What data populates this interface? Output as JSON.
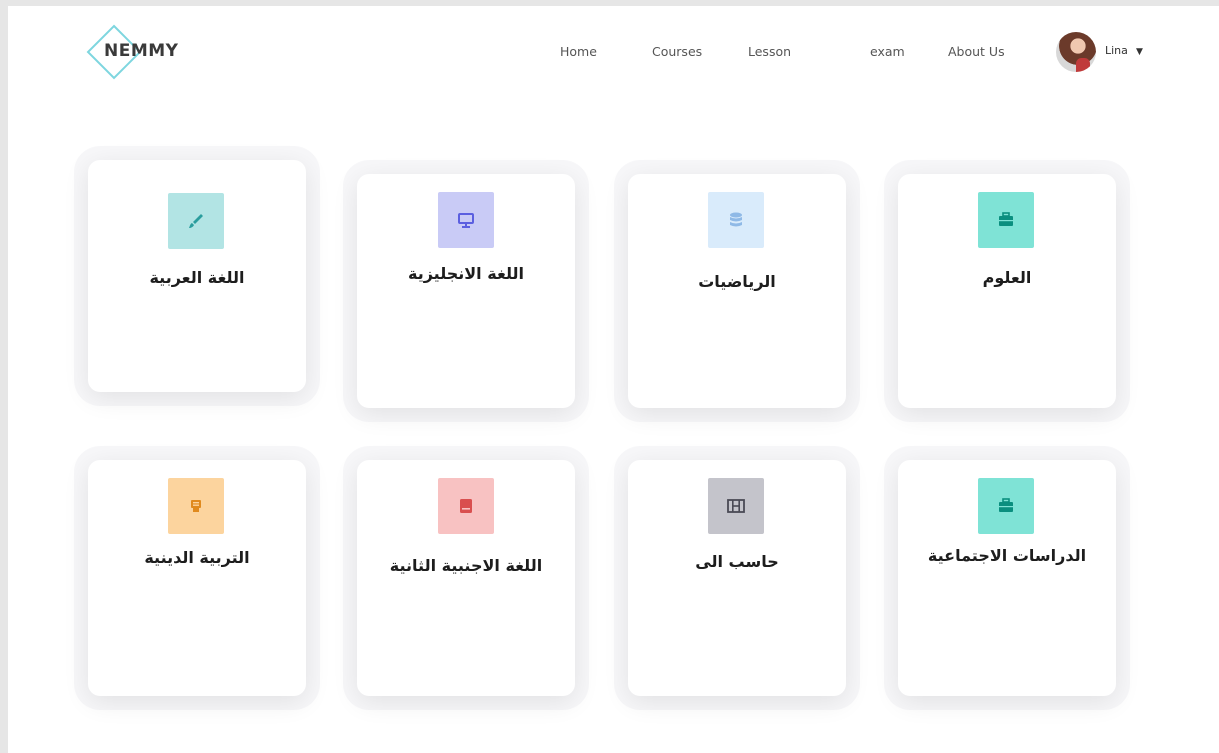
{
  "brand": {
    "logo_text": "NEMMY",
    "accent": "#7ed6df"
  },
  "nav": {
    "items": [
      {
        "label": "Home"
      },
      {
        "label": "Courses"
      },
      {
        "label": "Lesson"
      },
      {
        "label": "exam"
      },
      {
        "label": "About Us"
      }
    ]
  },
  "user": {
    "name": "Lina",
    "caret_icon": "caret-down-icon"
  },
  "subjects": [
    {
      "title": "اللغة العربية",
      "icon": "brush-icon",
      "icon_bg": "#b2e4e4",
      "icon_color": "#2a9d9d"
    },
    {
      "title": "اللغة الانجليزية",
      "icon": "monitor-icon",
      "icon_bg": "#c9cbf6",
      "icon_color": "#5b5fe0"
    },
    {
      "title": "الرياضيات",
      "icon": "database-icon",
      "icon_bg": "#d9ebfb",
      "icon_color": "#8fb9e6"
    },
    {
      "title": "العلوم",
      "icon": "briefcase-icon",
      "icon_bg": "#7fe3d6",
      "icon_color": "#0a8f7f"
    },
    {
      "title": "التربية الدينية",
      "icon": "stamp-icon",
      "icon_bg": "#fcd49e",
      "icon_color": "#e08a1e"
    },
    {
      "title": "اللغة الاجنبية الثانية",
      "icon": "book-icon",
      "icon_bg": "#f8c2c2",
      "icon_color": "#d94f4f"
    },
    {
      "title": "حاسب الى",
      "icon": "film-icon",
      "icon_bg": "#c4c4cb",
      "icon_color": "#4a4a55"
    },
    {
      "title": "الدراسات الاجتماعية",
      "icon": "briefcase-icon",
      "icon_bg": "#7fe3d6",
      "icon_color": "#0a8f7f"
    }
  ]
}
